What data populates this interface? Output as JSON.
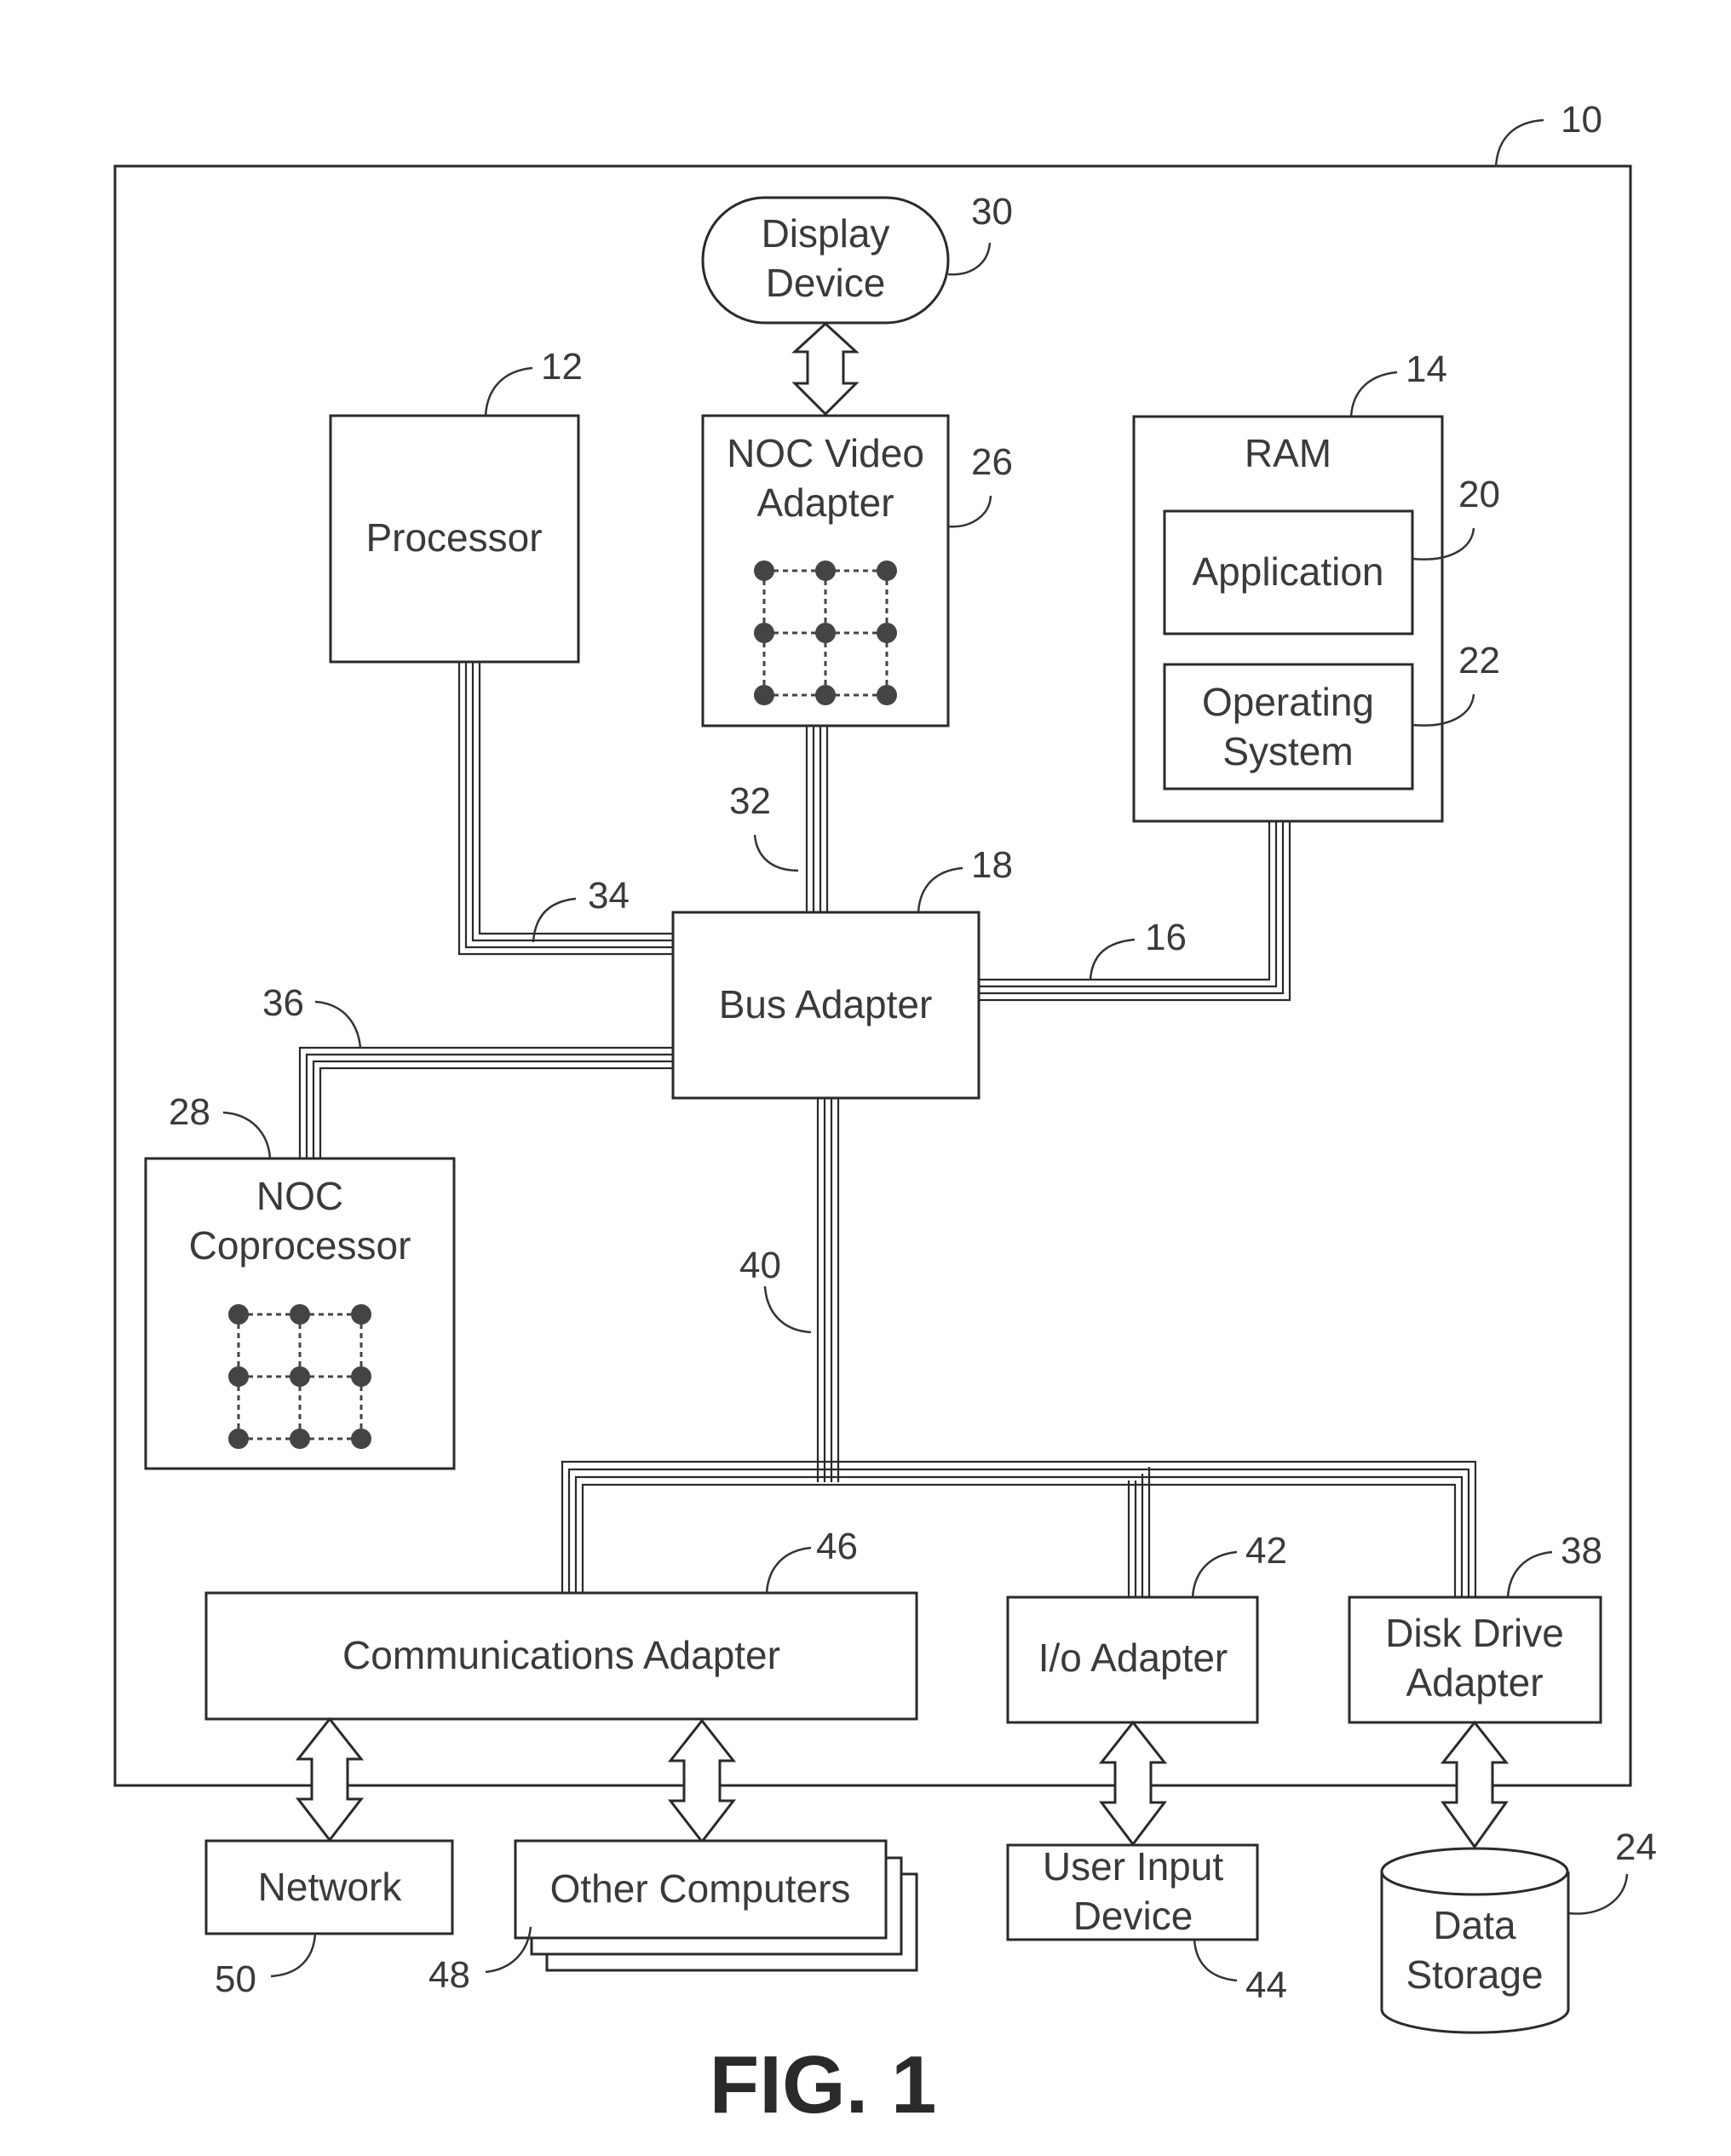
{
  "figure": {
    "caption": "FIG. 1"
  },
  "system": {
    "ref": "10"
  },
  "components": {
    "display_device": {
      "lines": [
        "Display",
        "Device"
      ],
      "ref": "30"
    },
    "processor": {
      "label": "Processor",
      "ref": "12"
    },
    "noc_video_adapter": {
      "lines": [
        "NOC Video",
        "Adapter"
      ],
      "ref": "26"
    },
    "ram": {
      "label": "RAM",
      "ref": "14"
    },
    "application": {
      "label": "Application",
      "ref": "20"
    },
    "operating_system": {
      "lines": [
        "Operating",
        "System"
      ],
      "ref": "22"
    },
    "bus_adapter": {
      "label": "Bus Adapter",
      "ref": "18"
    },
    "noc_coprocessor": {
      "lines": [
        "NOC",
        "Coprocessor"
      ],
      "ref": "28"
    },
    "communications_adapter": {
      "label": "Communications Adapter",
      "ref": "46"
    },
    "io_adapter": {
      "label": "I/o Adapter",
      "ref": "42"
    },
    "disk_drive_adapter": {
      "lines": [
        "Disk Drive",
        "Adapter"
      ],
      "ref": "38"
    },
    "network": {
      "label": "Network",
      "ref": "50"
    },
    "other_computers": {
      "label": "Other Computers",
      "ref": "48"
    },
    "user_input_device": {
      "lines": [
        "User Input",
        "Device"
      ],
      "ref": "44"
    },
    "data_storage": {
      "lines": [
        "Data",
        "Storage"
      ],
      "ref": "24"
    }
  },
  "buses": {
    "memory_bus": {
      "ref": "16"
    },
    "video_bus": {
      "ref": "32"
    },
    "front_side_bus": {
      "ref": "34"
    },
    "coprocessor_bus": {
      "ref": "36"
    },
    "expansion_bus": {
      "ref": "40"
    }
  }
}
